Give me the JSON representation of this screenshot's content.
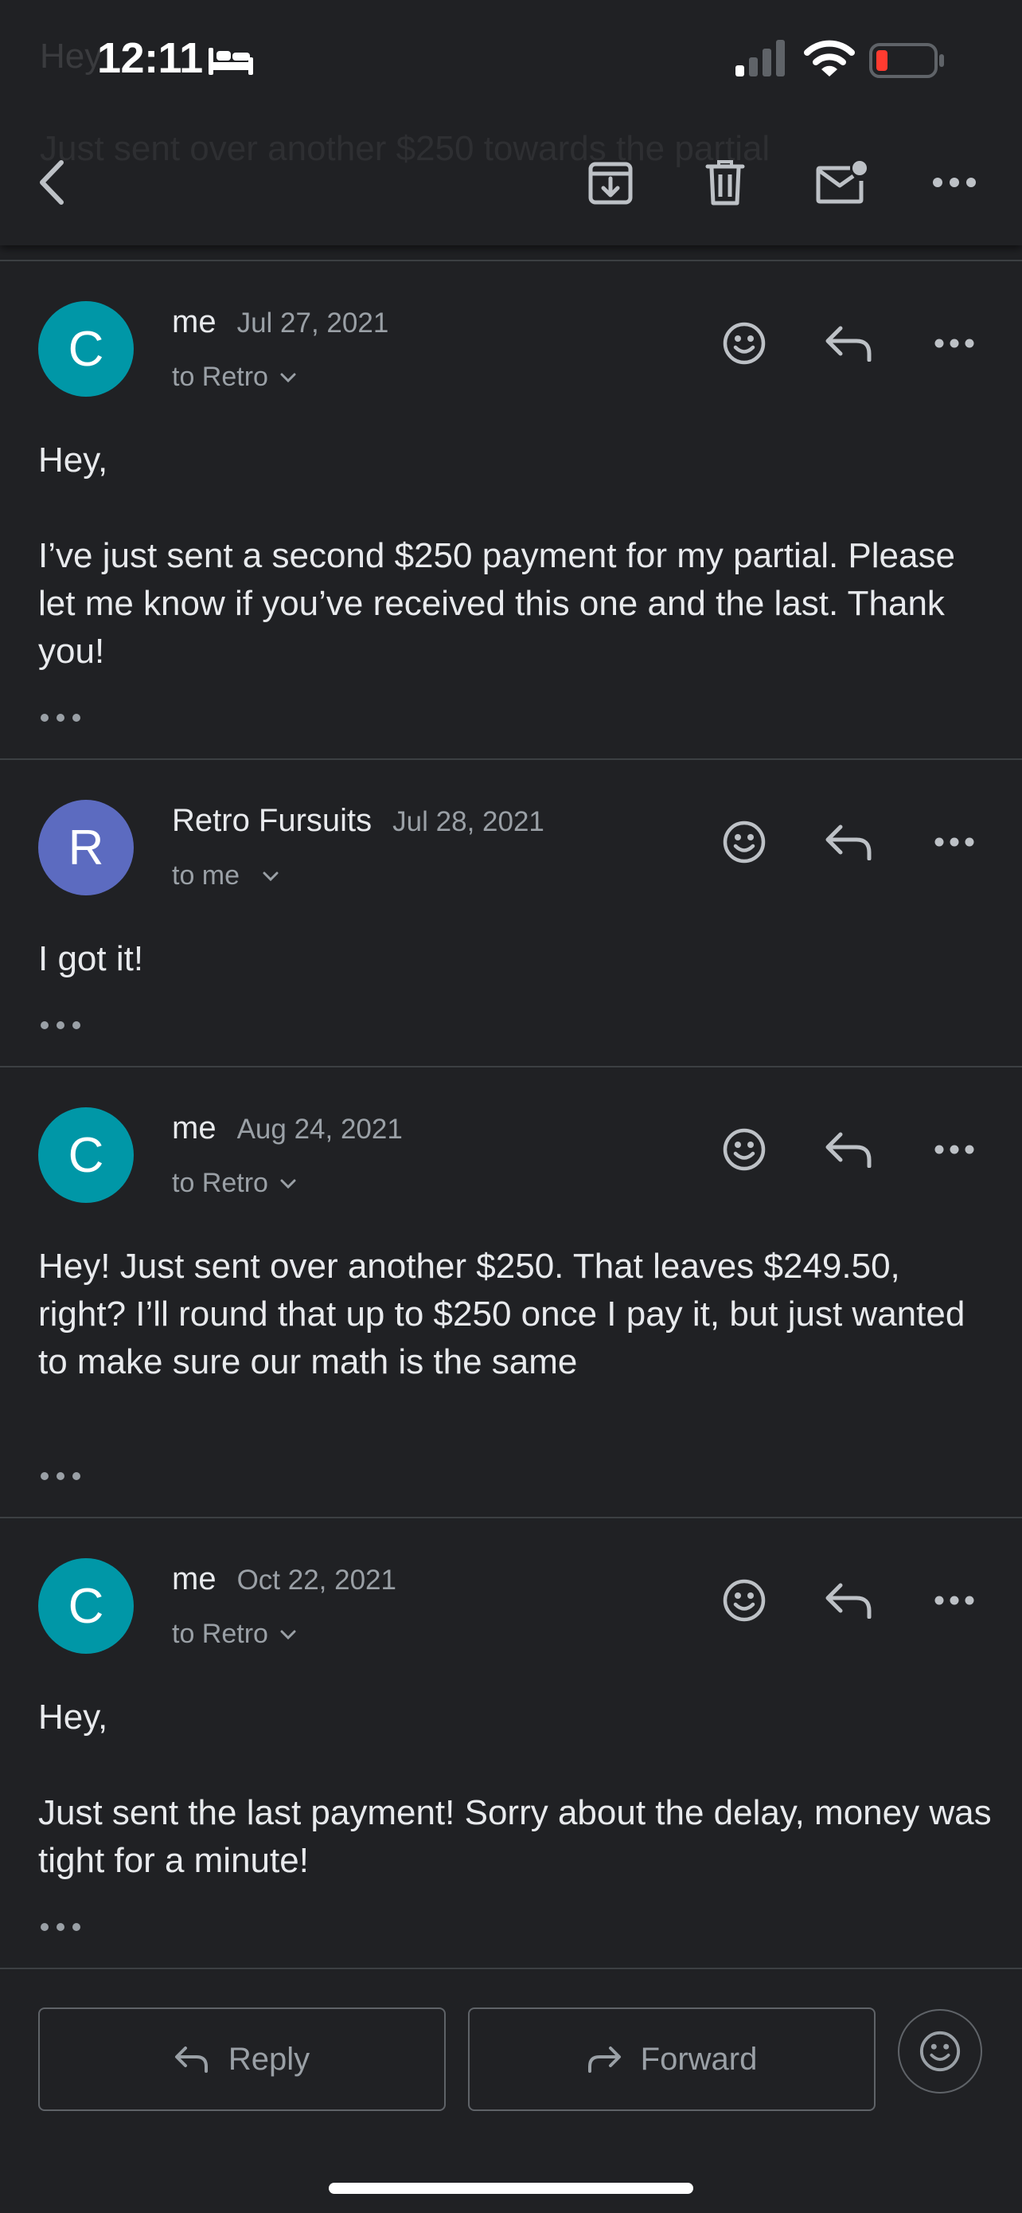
{
  "status_bar": {
    "time": "12:11",
    "icons": [
      "bed-icon",
      "cellular-signal-icon",
      "wifi-icon",
      "battery-low-icon"
    ]
  },
  "ghost_subject": {
    "line1": "Hey",
    "line2": "Just sent over another $250 towards the partial"
  },
  "toolbar": {
    "icons": [
      "back-icon",
      "archive-icon",
      "delete-icon",
      "mark-unread-icon",
      "more-icon"
    ]
  },
  "colors": {
    "background": "#202124",
    "avatar_me": "#0097a7",
    "avatar_retro": "#5c6bc0",
    "divider": "#3c4043",
    "secondary_text": "#9aa0a6"
  },
  "messages": [
    {
      "avatar_letter": "C",
      "sender": "me",
      "date": "Jul 27, 2021",
      "recipient": "to Retro",
      "body": [
        "Hey,",
        "I’ve just sent a second $250 payment for my partial. Please let me know if you’ve received this one and the last. Thank you!"
      ]
    },
    {
      "avatar_letter": "R",
      "sender": "Retro Fursuits",
      "date": "Jul 28, 2021",
      "recipient": "to me",
      "body": [
        "I got it!"
      ]
    },
    {
      "avatar_letter": "C",
      "sender": "me",
      "date": "Aug 24, 2021",
      "recipient": "to Retro",
      "body": [
        "Hey! Just sent over another $250. That leaves $249.50, right? I’ll round that up to $250 once I pay it, but just wanted to make sure our math is the same"
      ]
    },
    {
      "avatar_letter": "C",
      "sender": "me",
      "date": "Oct 22, 2021",
      "recipient": "to Retro",
      "body": [
        "Hey,",
        "Just sent the last payment! Sorry about the delay, money was tight for a minute!"
      ]
    }
  ],
  "bottom_bar": {
    "reply_label": "Reply",
    "forward_label": "Forward"
  }
}
